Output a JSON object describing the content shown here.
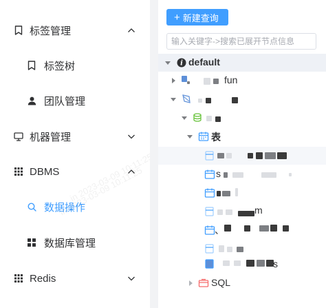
{
  "sidebar": {
    "items": [
      {
        "label": "标签管理",
        "icon": "bookmark-icon",
        "expanded": true
      },
      {
        "label": "标签树",
        "icon": "bookmark-icon"
      },
      {
        "label": "团队管理",
        "icon": "user-icon"
      },
      {
        "label": "机器管理",
        "icon": "monitor-icon",
        "expanded": false
      },
      {
        "label": "DBMS",
        "icon": "grid-icon",
        "expanded": true
      },
      {
        "label": "数据操作",
        "icon": "search-icon",
        "active": true
      },
      {
        "label": "数据库管理",
        "icon": "apps-icon"
      },
      {
        "label": "Redis",
        "icon": "grid-icon",
        "expanded": false
      }
    ]
  },
  "toolbar": {
    "new_query_label": "新建查询"
  },
  "search": {
    "placeholder": "输入关键字->搜索已展开节点信息"
  },
  "tree": {
    "root_label": "default",
    "fragments": {
      "instance_suffix": "fun",
      "table_folder": "表",
      "table_prefix": "s",
      "table_suffix": "m",
      "table_mark": "、",
      "table_tail": "s",
      "sql_folder": "SQL"
    }
  },
  "watermark": {
    "text": "in 2023-03-09 10:11:25"
  },
  "colors": {
    "accent": "#409eff",
    "text": "#303133",
    "panel_bg": "#f2f3f5",
    "highlight": "#eef1f6"
  }
}
